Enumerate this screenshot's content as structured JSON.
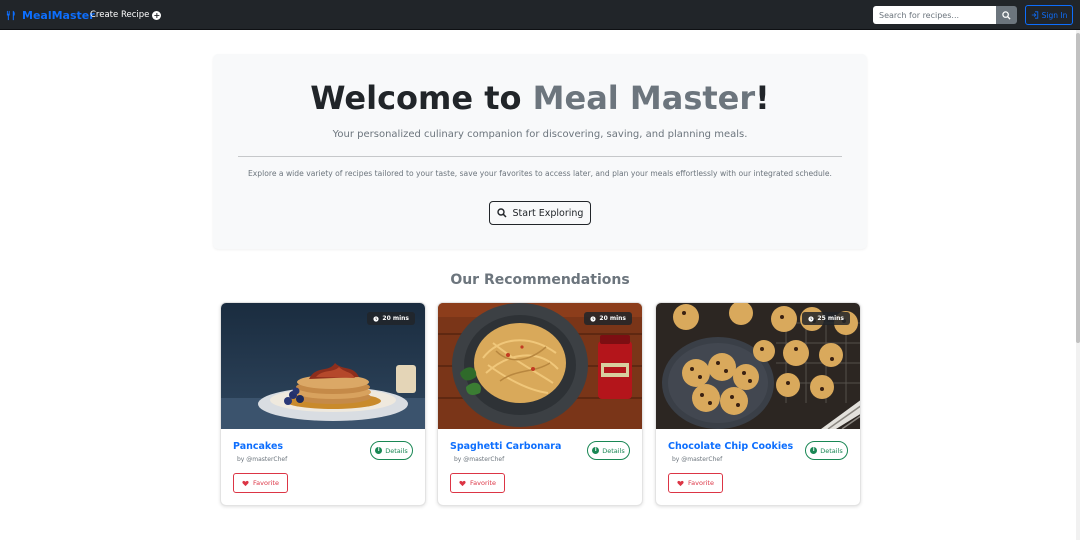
{
  "navbar": {
    "brand": "MealMaster",
    "create_recipe": "Create Recipe",
    "search_placeholder": "Search for recipes...",
    "signin": "Sign In"
  },
  "hero": {
    "title_main": "Welcome to ",
    "title_accent": "Meal Master",
    "title_end": "!",
    "subtitle": "Your personalized culinary companion for discovering, saving, and planning meals.",
    "text": "Explore a wide variety of recipes tailored to your taste, save your favorites to access later, and plan your meals effortlessly with our integrated schedule.",
    "button": "Start Exploring"
  },
  "recommendations": {
    "title": "Our Recommendations",
    "cards": [
      {
        "title": "Pancakes",
        "author": "by @masterChef",
        "time": "20 mins",
        "details": "Details",
        "favorite": "Favorite"
      },
      {
        "title": "Spaghetti Carbonara",
        "author": "by @masterChef",
        "time": "20 mins",
        "details": "Details",
        "favorite": "Favorite"
      },
      {
        "title": "Chocolate Chip Cookies",
        "author": "by @masterChef",
        "time": "25 mins",
        "details": "Details",
        "favorite": "Favorite"
      }
    ]
  },
  "colors": {
    "primary": "#0d6efd",
    "navbar_bg": "#212529",
    "success": "#198754",
    "danger": "#dc3545",
    "muted": "#6c757d"
  }
}
